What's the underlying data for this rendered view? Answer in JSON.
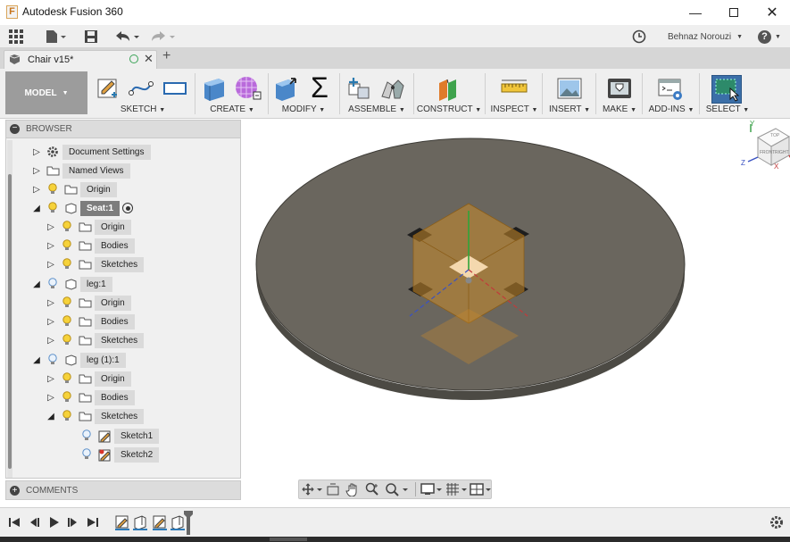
{
  "app": {
    "title": "Autodesk Fusion 360",
    "user": "Behnaz Norouzi",
    "help": "?"
  },
  "document": {
    "tab_title": "Chair v15*"
  },
  "workspace": {
    "label": "MODEL"
  },
  "ribbon": {
    "groups": [
      {
        "label": "SKETCH"
      },
      {
        "label": "CREATE"
      },
      {
        "label": "MODIFY"
      },
      {
        "label": "ASSEMBLE"
      },
      {
        "label": "CONSTRUCT"
      },
      {
        "label": "INSPECT"
      },
      {
        "label": "INSERT"
      },
      {
        "label": "MAKE"
      },
      {
        "label": "ADD-INS"
      },
      {
        "label": "SELECT"
      }
    ]
  },
  "browser": {
    "header": "BROWSER",
    "items": [
      {
        "label": "Document Settings",
        "icon": "gear-icon"
      },
      {
        "label": "Named Views",
        "icon": "folder-icon"
      },
      {
        "label": "Origin",
        "icon": "folder-icon"
      },
      {
        "label": "Seat:1",
        "icon": "component-icon"
      },
      {
        "label": "Origin",
        "icon": "folder-icon"
      },
      {
        "label": "Bodies",
        "icon": "folder-icon"
      },
      {
        "label": "Sketches",
        "icon": "folder-icon"
      },
      {
        "label": "leg:1",
        "icon": "component-icon"
      },
      {
        "label": "Origin",
        "icon": "folder-icon"
      },
      {
        "label": "Bodies",
        "icon": "folder-icon"
      },
      {
        "label": "Sketches",
        "icon": "folder-icon"
      },
      {
        "label": "leg (1):1",
        "icon": "component-icon"
      },
      {
        "label": "Origin",
        "icon": "folder-icon"
      },
      {
        "label": "Bodies",
        "icon": "folder-icon"
      },
      {
        "label": "Sketches",
        "icon": "folder-icon"
      },
      {
        "label": "Sketch1",
        "icon": "sketch-icon"
      },
      {
        "label": "Sketch2",
        "icon": "sketch-icon"
      }
    ]
  },
  "comments": {
    "header": "COMMENTS"
  },
  "viewcube": {
    "top": "TOP",
    "front": "FRONT",
    "right": "RIGHT",
    "axis_x": "X",
    "axis_y": "Y",
    "axis_z": "Z"
  },
  "colors": {
    "accent": "#2d7ab8",
    "select_active": "#3b6fa8",
    "seat_top": "#6a665e",
    "seat_edge": "#4c4a44",
    "leg_fill": "#c98a2a"
  }
}
